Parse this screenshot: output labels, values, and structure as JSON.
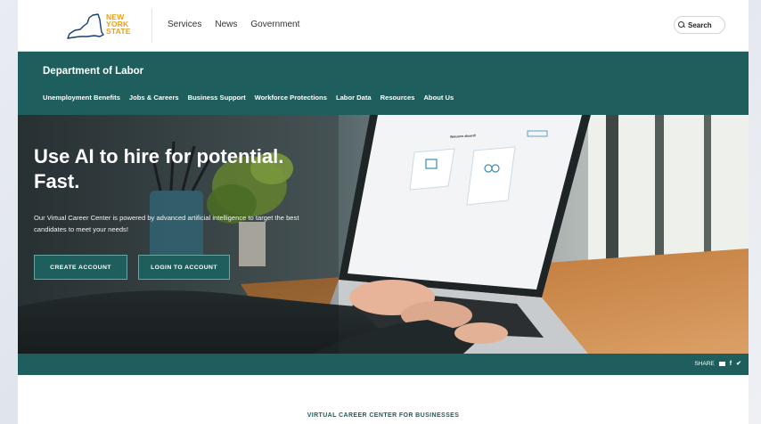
{
  "header": {
    "logo": {
      "line1": "NEW",
      "line2": "YORK",
      "line3": "STATE"
    },
    "nav": [
      "Services",
      "News",
      "Government"
    ],
    "search_label": "Search"
  },
  "department": {
    "title": "Department of Labor",
    "nav": [
      "Unemployment Benefits",
      "Jobs & Careers",
      "Business Support",
      "Workforce Protections",
      "Labor Data",
      "Resources",
      "About Us"
    ]
  },
  "hero": {
    "title_line1": "Use AI to hire for potential.",
    "title_line2": "Fast.",
    "description": "Our Virtual Career Center is powered by advanced artificial intelligence to target the best candidates to meet your needs!",
    "create_button": "CREATE ACCOUNT",
    "login_button": "LOGIN TO ACCOUNT",
    "screen": {
      "welcome": "Welcome aboard!"
    }
  },
  "share": {
    "label": "SHARE"
  },
  "section": {
    "heading": "VIRTUAL CAREER CENTER FOR BUSINESSES"
  },
  "colors": {
    "brand_teal": "#1e5e5d",
    "logo_gold": "#e8a21a",
    "logo_navy": "#1a3d6e"
  }
}
